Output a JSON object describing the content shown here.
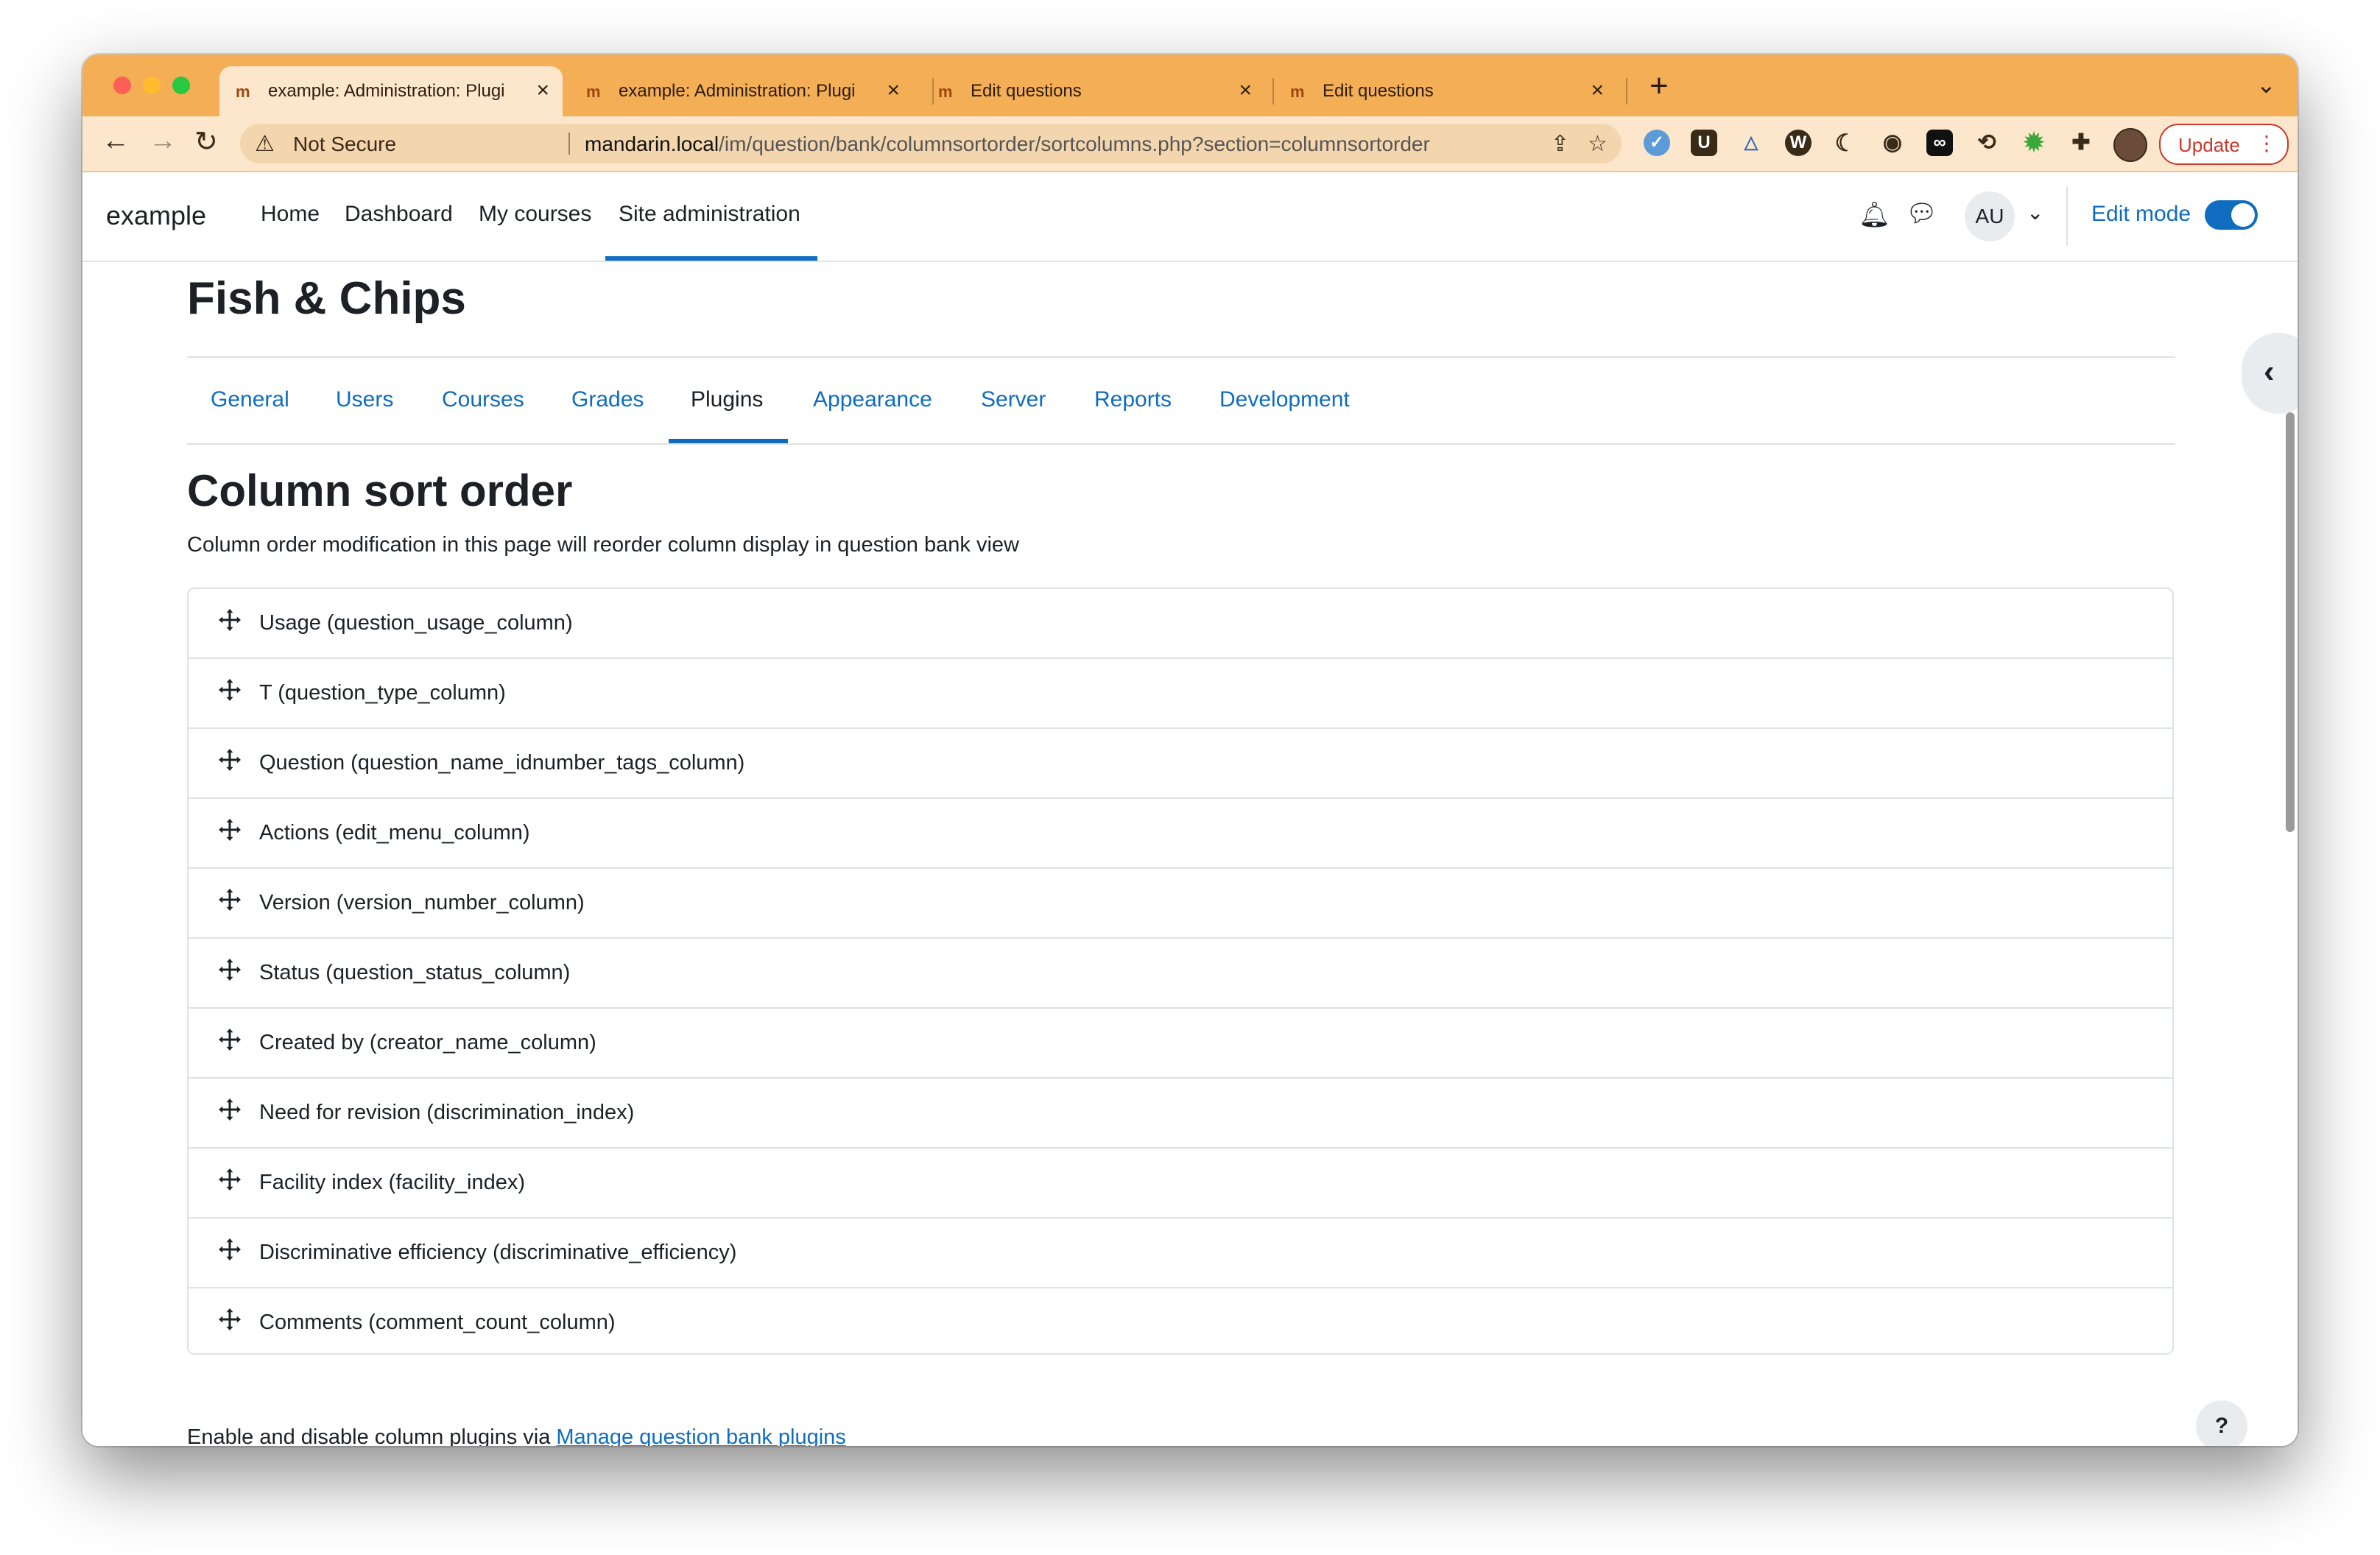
{
  "browser": {
    "tabs": [
      {
        "title": "example: Administration: Plugi",
        "active": true
      },
      {
        "title": "example: Administration: Plugi",
        "active": false
      },
      {
        "title": "Edit questions",
        "active": false
      },
      {
        "title": "Edit questions",
        "active": false
      }
    ],
    "security_label": "Not Secure",
    "url_host": "mandarin.local",
    "url_path": "/im/question/bank/columnsortorder/sortcolumns.php?section=columnsortorder",
    "update_label": "Update",
    "accent_color": "#f4ae55"
  },
  "nav": {
    "brand": "example",
    "links": [
      "Home",
      "Dashboard",
      "My courses",
      "Site administration"
    ],
    "active_link": "Site administration",
    "user_initials": "AU",
    "edit_mode_label": "Edit mode",
    "edit_mode_on": true
  },
  "page": {
    "title": "Fish & Chips",
    "tabs": [
      "General",
      "Users",
      "Courses",
      "Grades",
      "Plugins",
      "Appearance",
      "Server",
      "Reports",
      "Development"
    ],
    "active_tab": "Plugins",
    "heading": "Column sort order",
    "description": "Column order modification in this page will reorder column display in question bank view",
    "columns": [
      "Usage (question_usage_column)",
      "T (question_type_column)",
      "Question (question_name_idnumber_tags_column)",
      "Actions (edit_menu_column)",
      "Version (version_number_column)",
      "Status (question_status_column)",
      "Created by (creator_name_column)",
      "Need for revision (discrimination_index)",
      "Facility index (facility_index)",
      "Discriminative efficiency (discriminative_efficiency)",
      "Comments (comment_count_column)"
    ],
    "footer_text": "Enable and disable column plugins via ",
    "footer_link": "Manage question bank plugins",
    "help_label": "?"
  }
}
